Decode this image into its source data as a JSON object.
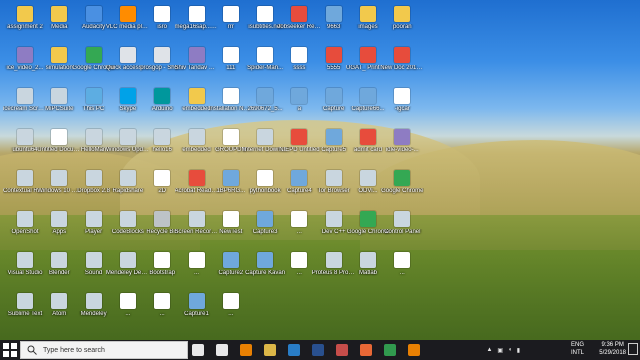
{
  "desktop": {
    "icons": [
      {
        "label": "assignment 2",
        "icon": "folder-icon"
      },
      {
        "label": "Media",
        "icon": "folder-icon"
      },
      {
        "label": "Audacity",
        "icon": "audacity-icon"
      },
      {
        "label": "VLC media player",
        "icon": "vlc-icon"
      },
      {
        "label": "isro",
        "icon": "document-icon"
      },
      {
        "label": "mega16sap... reddy.work...",
        "icon": "document-icon"
      },
      {
        "label": "rrr",
        "icon": "document-icon"
      },
      {
        "label": "isubtitles.net",
        "icon": "document-icon"
      },
      {
        "label": "Jobseeker Report",
        "icon": "pdf-icon"
      },
      {
        "label": "9663",
        "icon": "image-icon"
      },
      {
        "label": "images",
        "icon": "folder-icon"
      },
      {
        "label": "pooran",
        "icon": "folder-icon"
      },
      {
        "label": "ice_video_2...",
        "icon": "video-icon"
      },
      {
        "label": "simulation",
        "icon": "folder-icon"
      },
      {
        "label": "Google Chrome",
        "icon": "chrome-icon"
      },
      {
        "label": "Quick access - Shortcut",
        "icon": "shortcut-icon"
      },
      {
        "label": "prosgop - Shortcut",
        "icon": "shortcut-icon"
      },
      {
        "label": "Shiv Tandav DubStep M...",
        "icon": "video-icon"
      },
      {
        "label": "111",
        "icon": "document-icon"
      },
      {
        "label": "Spider-Man...",
        "icon": "document-icon"
      },
      {
        "label": "ssss",
        "icon": "document-icon"
      },
      {
        "label": "5555",
        "icon": "pdf-icon"
      },
      {
        "label": "UGAT_ Print Application",
        "icon": "pdf-icon"
      },
      {
        "label": "New Doc 2018-05-24",
        "icon": "pdf-icon"
      },
      {
        "label": "icecream Screen ...",
        "icon": "app-icon"
      },
      {
        "label": "MiPCSuite",
        "icon": "app-icon"
      },
      {
        "label": "This PC",
        "icon": "pc-icon"
      },
      {
        "label": "Skype",
        "icon": "skype-icon"
      },
      {
        "label": "Arduino",
        "icon": "arduino-icon"
      },
      {
        "label": "embedded",
        "icon": "folder-icon"
      },
      {
        "label": "Installation Number",
        "icon": "document-icon"
      },
      {
        "label": "2690672_5...",
        "icon": "image-icon"
      },
      {
        "label": "a",
        "icon": "image-icon"
      },
      {
        "label": "Capture",
        "icon": "image-icon"
      },
      {
        "label": "Capture66...",
        "icon": "image-icon"
      },
      {
        "label": "-igcar",
        "icon": "document-icon"
      },
      {
        "label": "ubuntu64",
        "icon": "app-icon"
      },
      {
        "label": "Untitled Document",
        "icon": "document-icon"
      },
      {
        "label": "HelloMan",
        "icon": "app-icon"
      },
      {
        "label": "Windows Update Center",
        "icon": "app-icon"
      },
      {
        "label": "hello16",
        "icon": "app-icon"
      },
      {
        "label": "embedded",
        "icon": "app-icon"
      },
      {
        "label": "GROUPDM",
        "icon": "document-icon"
      },
      {
        "label": "Internet Downlo...",
        "icon": "app-icon"
      },
      {
        "label": "NIEPD Untitled",
        "icon": "pdf-icon"
      },
      {
        "label": "Capture5",
        "icon": "image-icon"
      },
      {
        "label": "admit card",
        "icon": "pdf-icon"
      },
      {
        "label": "idle-video-...",
        "icon": "video-icon"
      },
      {
        "label": "Contextual Reality 3D",
        "icon": "app-icon"
      },
      {
        "label": "Windows 10 Upgrade...",
        "icon": "app-icon"
      },
      {
        "label": "Dropbox 2.8",
        "icon": "app-icon"
      },
      {
        "label": "Rapidshare",
        "icon": "app-icon"
      },
      {
        "label": "2D",
        "icon": "document-icon"
      },
      {
        "label": "Acrobat Reader DC",
        "icon": "pdf-icon"
      },
      {
        "label": "1BP6RG...",
        "icon": "image-icon"
      },
      {
        "label": "pythonbook",
        "icon": "document-icon"
      },
      {
        "label": "Capture4",
        "icon": "image-icon"
      },
      {
        "label": "Tor Browser",
        "icon": "app-icon"
      },
      {
        "label": "ODVi...",
        "icon": "app-icon"
      },
      {
        "label": "Google Chrome",
        "icon": "chrome-icon"
      },
      {
        "label": "OpenShot",
        "icon": "app-icon"
      },
      {
        "label": "Apps",
        "icon": "app-icon"
      },
      {
        "label": "Player",
        "icon": "app-icon"
      },
      {
        "label": "CodeBlocks",
        "icon": "app-icon"
      },
      {
        "label": "Recycle Bin",
        "icon": "bin-icon"
      },
      {
        "label": "Screen Recorder",
        "icon": "app-icon"
      },
      {
        "label": "NewTest",
        "icon": "document-icon"
      },
      {
        "label": "Capture3",
        "icon": "image-icon"
      },
      {
        "label": "...",
        "icon": "document-icon"
      },
      {
        "label": "Dev C++",
        "icon": "app-icon"
      },
      {
        "label": "Google Chrome",
        "icon": "chrome-icon"
      },
      {
        "label": "Control Panel",
        "icon": "app-icon"
      },
      {
        "label": "Visual Studio",
        "icon": "app-icon"
      },
      {
        "label": "Blender",
        "icon": "app-icon"
      },
      {
        "label": "Sound",
        "icon": "app-icon"
      },
      {
        "label": "Mendeley Desktop",
        "icon": "app-icon"
      },
      {
        "label": "Bootstrap",
        "icon": "document-icon"
      },
      {
        "label": "...",
        "icon": "document-icon"
      },
      {
        "label": "Capture2",
        "icon": "image-icon"
      },
      {
        "label": "Capture Kavan",
        "icon": "image-icon"
      },
      {
        "label": "...",
        "icon": "document-icon"
      },
      {
        "label": "Proteus 8 Professional",
        "icon": "app-icon"
      },
      {
        "label": "Matlab",
        "icon": "app-icon"
      },
      {
        "label": "...",
        "icon": "document-icon"
      },
      {
        "label": "Sublime Text",
        "icon": "app-icon"
      },
      {
        "label": "Atom",
        "icon": "app-icon"
      },
      {
        "label": "Mendeley",
        "icon": "app-icon"
      },
      {
        "label": "...",
        "icon": "document-icon"
      },
      {
        "label": "...",
        "icon": "document-icon"
      },
      {
        "label": "Capture1",
        "icon": "image-icon"
      },
      {
        "label": "...",
        "icon": "document-icon"
      }
    ]
  },
  "taskbar": {
    "search_placeholder": "Type here to search",
    "pinned": [
      {
        "icon": "mic-icon"
      },
      {
        "icon": "task-view-icon"
      },
      {
        "icon": "vlc-icon"
      },
      {
        "icon": "file-explorer-icon"
      },
      {
        "icon": "store-icon"
      },
      {
        "icon": "word-icon"
      },
      {
        "icon": "acrobat-icon"
      },
      {
        "icon": "firefox-icon"
      },
      {
        "icon": "chrome-icon"
      },
      {
        "icon": "media-icon"
      }
    ],
    "language_top": "ENG",
    "language_bottom": "INTL",
    "time": "9:36 PM",
    "date": "5/29/2018"
  }
}
